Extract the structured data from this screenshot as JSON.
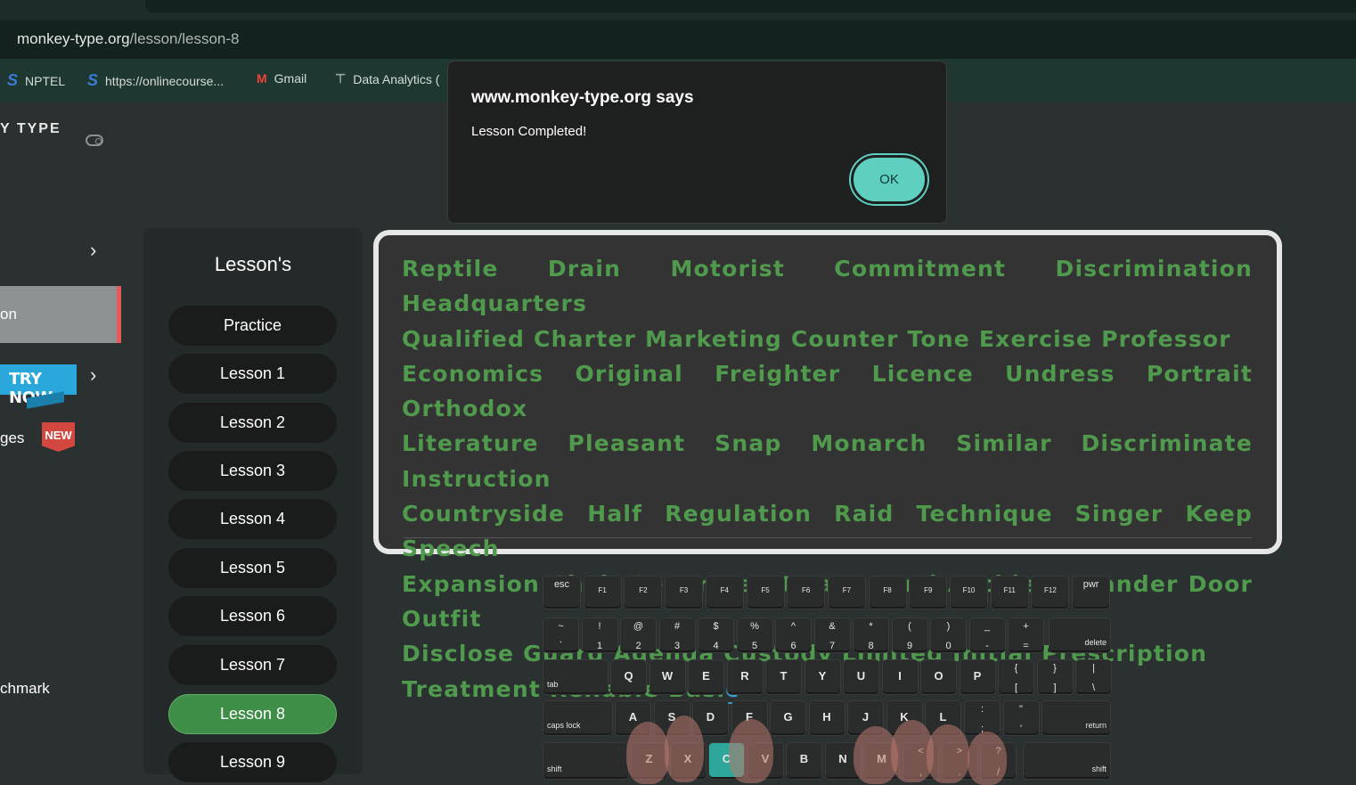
{
  "browser": {
    "url_host": "monkey-type.org",
    "url_path": "/lesson/lesson-8",
    "bookmarks": [
      {
        "label": "NPTEL",
        "icon": "s-logo-icon"
      },
      {
        "label": "https://onlinecourse...",
        "icon": "s-logo-icon"
      },
      {
        "label": "Gmail",
        "icon": "gmail-icon"
      },
      {
        "label": "Data Analytics (",
        "icon": "bookmark-icon"
      }
    ]
  },
  "sidebar": {
    "brand": "Y TYPE",
    "active_item": "on",
    "try_now": "TRY NOW",
    "challenges_label": "ges",
    "new_badge": "NEW",
    "benchmark_label": "chmark"
  },
  "lessons": {
    "title": "Lesson's",
    "items": [
      "Practice",
      "Lesson 1",
      "Lesson 2",
      "Lesson 3",
      "Lesson 4",
      "Lesson 5",
      "Lesson 6",
      "Lesson 7",
      "Lesson 8",
      "Lesson 9"
    ],
    "active_index": 8
  },
  "typing": {
    "lines": [
      "Reptile Drain Motorist Commitment Discrimination Headquarters",
      "Qualified Charter Marketing Counter Tone Exercise Professor",
      "Economics Original Freighter Licence Undress Portrait Orthodox",
      "Literature Pleasant Snap Monarch Similar Discriminate Instruction",
      "Countryside Half Regulation Raid Technique Singer Keep Speech",
      "Expansion Chair Separate Attract Bond Accident Wander Door Outfit",
      "Disclose Guard Agenda Custody Limited Initial Prescription"
    ],
    "last_line_typed": "Treatment Reliable Basi",
    "last_line_cursor_char": "c"
  },
  "dialog": {
    "title": "www.monkey-type.org says",
    "message": "Lesson Completed!",
    "ok_label": "OK"
  },
  "keyboard": {
    "fn_row": [
      "esc",
      "F1",
      "F2",
      "F3",
      "F4",
      "F5",
      "F6",
      "F7",
      "F8",
      "F9",
      "F10",
      "F11",
      "F12",
      "pwr"
    ],
    "num_row": [
      [
        "~",
        "`"
      ],
      [
        "!",
        "1"
      ],
      [
        "@",
        "2"
      ],
      [
        "#",
        "3"
      ],
      [
        "$",
        "4"
      ],
      [
        "%",
        "5"
      ],
      [
        "^",
        "6"
      ],
      [
        "&",
        "7"
      ],
      [
        "*",
        "8"
      ],
      [
        "(",
        "9"
      ],
      [
        ")",
        "0"
      ],
      [
        "_",
        "-"
      ],
      [
        "+",
        "="
      ]
    ],
    "delete_label": "delete",
    "tab_label": "tab",
    "top_row": [
      "Q",
      "W",
      "E",
      "R",
      "T",
      "Y",
      "U",
      "I",
      "O",
      "P"
    ],
    "top_row_extra": [
      [
        "{",
        "["
      ],
      [
        "}",
        "]"
      ],
      [
        "|",
        "\\"
      ]
    ],
    "caps_label": "caps lock",
    "home_row": [
      "A",
      "S",
      "D",
      "F",
      "G",
      "H",
      "J",
      "K",
      "L"
    ],
    "home_row_extra": [
      [
        ":",
        ";"
      ],
      [
        "\"",
        "'"
      ]
    ],
    "return_label": "return",
    "shift_label": "shift",
    "bottom_row": [
      "Z",
      "X",
      "C",
      "V",
      "B",
      "N",
      "M"
    ],
    "bottom_row_extra": [
      [
        "<",
        ","
      ],
      [
        ">",
        "."
      ],
      [
        "?",
        "/"
      ]
    ],
    "highlighted_key": "C"
  }
}
